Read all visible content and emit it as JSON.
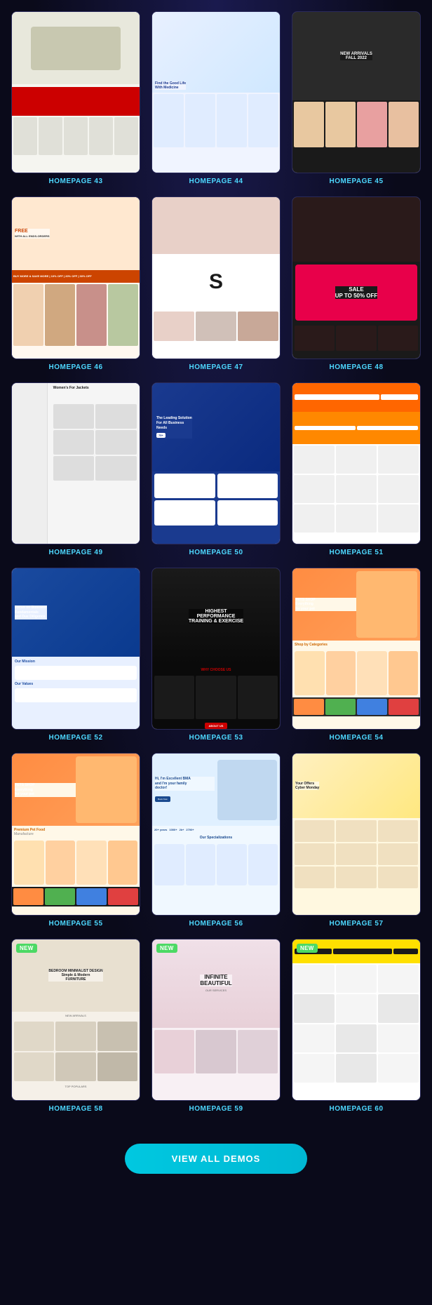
{
  "grid": {
    "items": [
      {
        "id": "hp43",
        "label": "HOMEPAGE 43",
        "isNew": false,
        "theme": "furniture"
      },
      {
        "id": "hp44",
        "label": "HOMEPAGE 44",
        "isNew": false,
        "theme": "medical"
      },
      {
        "id": "hp45",
        "label": "HOMEPAGE 45",
        "isNew": false,
        "theme": "fashion-fall"
      },
      {
        "id": "hp46",
        "label": "HOMEPAGE 46",
        "isNew": false,
        "theme": "clothing-free"
      },
      {
        "id": "hp47",
        "label": "HOMEPAGE 47",
        "isNew": false,
        "theme": "fashion-s"
      },
      {
        "id": "hp48",
        "label": "HOMEPAGE 48",
        "isNew": false,
        "theme": "sale-50"
      },
      {
        "id": "hp49",
        "label": "HOMEPAGE 49",
        "isNew": false,
        "theme": "jackets"
      },
      {
        "id": "hp50",
        "label": "HOMEPAGE 50",
        "isNew": false,
        "theme": "business"
      },
      {
        "id": "hp51",
        "label": "HOMEPAGE 51",
        "isNew": false,
        "theme": "electronics"
      },
      {
        "id": "hp52",
        "label": "HOMEPAGE 52",
        "isNew": false,
        "theme": "business-blue"
      },
      {
        "id": "hp53",
        "label": "HOMEPAGE 53",
        "isNew": false,
        "theme": "gym"
      },
      {
        "id": "hp54",
        "label": "HOMEPAGE 54",
        "isNew": false,
        "theme": "pets-shop"
      },
      {
        "id": "hp55",
        "label": "HOMEPAGE 55",
        "isNew": false,
        "theme": "pets-shop-2"
      },
      {
        "id": "hp56",
        "label": "HOMEPAGE 56",
        "isNew": false,
        "theme": "doctor"
      },
      {
        "id": "hp57",
        "label": "HOMEPAGE 57",
        "isNew": false,
        "theme": "cyber-monday"
      },
      {
        "id": "hp58",
        "label": "HOMEPAGE 58",
        "isNew": true,
        "theme": "modern-furniture"
      },
      {
        "id": "hp59",
        "label": "HOMEPAGE 59",
        "isNew": true,
        "theme": "beauty-infinite"
      },
      {
        "id": "hp60",
        "label": "HOMEPAGE 60",
        "isNew": true,
        "theme": "electronics-2"
      }
    ]
  },
  "cta": {
    "label": "VIEW ALL DEMOS"
  },
  "badge": {
    "new": "NEW"
  }
}
